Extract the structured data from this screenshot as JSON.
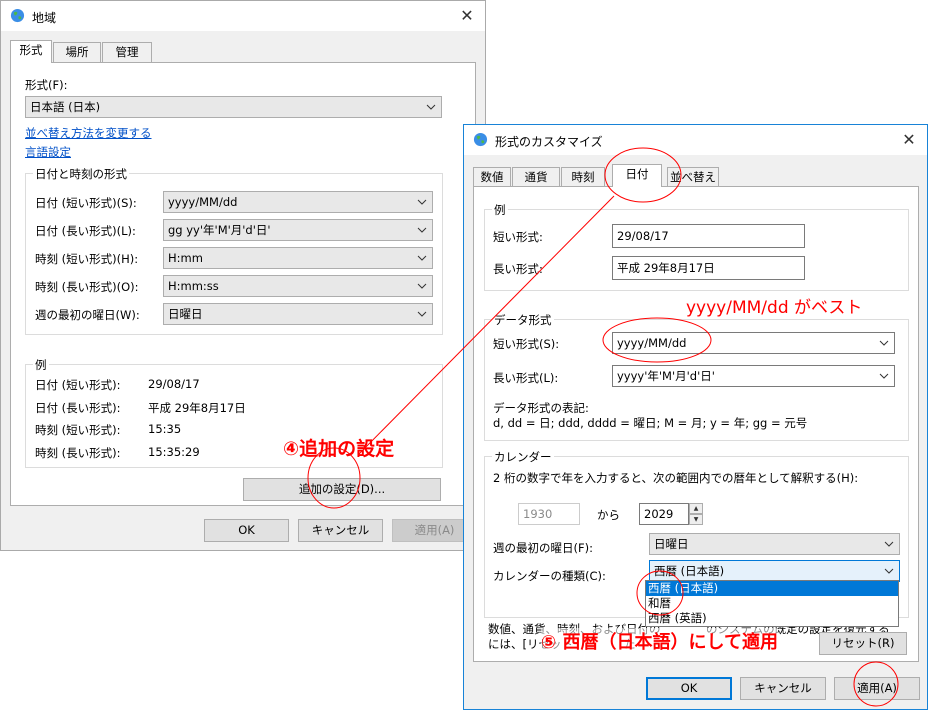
{
  "region_window": {
    "title": "地域",
    "tabs": [
      "形式",
      "場所",
      "管理"
    ],
    "format_label": "形式(F):",
    "format_value": "日本語 (日本)",
    "link_sort": "並べ替え方法を変更する",
    "link_language": "言語設定",
    "datetime_group_title": "日付と時刻の形式",
    "rows": [
      {
        "label": "日付 (短い形式)(S):",
        "value": "yyyy/MM/dd"
      },
      {
        "label": "日付 (長い形式)(L):",
        "value": "gg yy'年'M'月'd'日'"
      },
      {
        "label": "時刻 (短い形式)(H):",
        "value": "H:mm"
      },
      {
        "label": "時刻 (長い形式)(O):",
        "value": "H:mm:ss"
      },
      {
        "label": "週の最初の曜日(W):",
        "value": "日曜日"
      }
    ],
    "example_group_title": "例",
    "examples": [
      {
        "label": "日付 (短い形式):",
        "value": "29/08/17"
      },
      {
        "label": "日付 (長い形式):",
        "value": "平成 29年8月17日"
      },
      {
        "label": "時刻 (短い形式):",
        "value": "15:35"
      },
      {
        "label": "時刻 (長い形式):",
        "value": "15:35:29"
      }
    ],
    "additional_settings": "追加の設定(D)...",
    "ok": "OK",
    "cancel": "キャンセル",
    "apply": "適用(A)"
  },
  "customize_window": {
    "title": "形式のカスタマイズ",
    "tabs": [
      "数値",
      "通貨",
      "時刻",
      "日付",
      "並べ替え"
    ],
    "example_group_title": "例",
    "short_label": "短い形式:",
    "short_value": "29/08/17",
    "long_label": "長い形式:",
    "long_value": "平成 29年8月17日",
    "data_group_title": "データ形式",
    "data_short_label": "短い形式(S):",
    "data_short_value": "yyyy/MM/dd",
    "data_long_label": "長い形式(L):",
    "data_long_value": "yyyy'年'M'月'd'日'",
    "notation_title": "データ形式の表記:",
    "notation_text": "d, dd = 日;  ddd, dddd = 曜日; M = 月; y = 年; gg = 元号",
    "calendar_group_title": "カレンダー",
    "calendar_desc": "2 桁の数字で年を入力すると、次の範囲内での暦年として解釈する(H):",
    "year_from": "1930",
    "year_sep": "から",
    "year_to": "2029",
    "first_day_label": "週の最初の曜日(F):",
    "first_day_value": "日曜日",
    "calendar_type_label": "カレンダーの種類(C):",
    "calendar_type_value": "西暦 (日本語)",
    "calendar_options": [
      "西暦 (日本語)",
      "和暦",
      "西暦 (英語)"
    ],
    "footer_line1": "数値、通貨、時刻、および日付の",
    "footer_line1_tail": "のシステムの既定の設定を復元する",
    "footer_line2": "には、[リセット",
    "footer_line2_tail": "た",
    "reset": "リセット(R)",
    "ok": "OK",
    "cancel": "キャンセル",
    "apply": "適用(A)"
  },
  "annotations": {
    "best_format": "yyyy/MM/dd がベスト",
    "step4": "④追加の設定",
    "step5": "⑤ 西暦（日本語）にして適用"
  },
  "colors": {
    "annotation": "#ff0000",
    "link": "#0050c8",
    "accent": "#0078d7"
  }
}
